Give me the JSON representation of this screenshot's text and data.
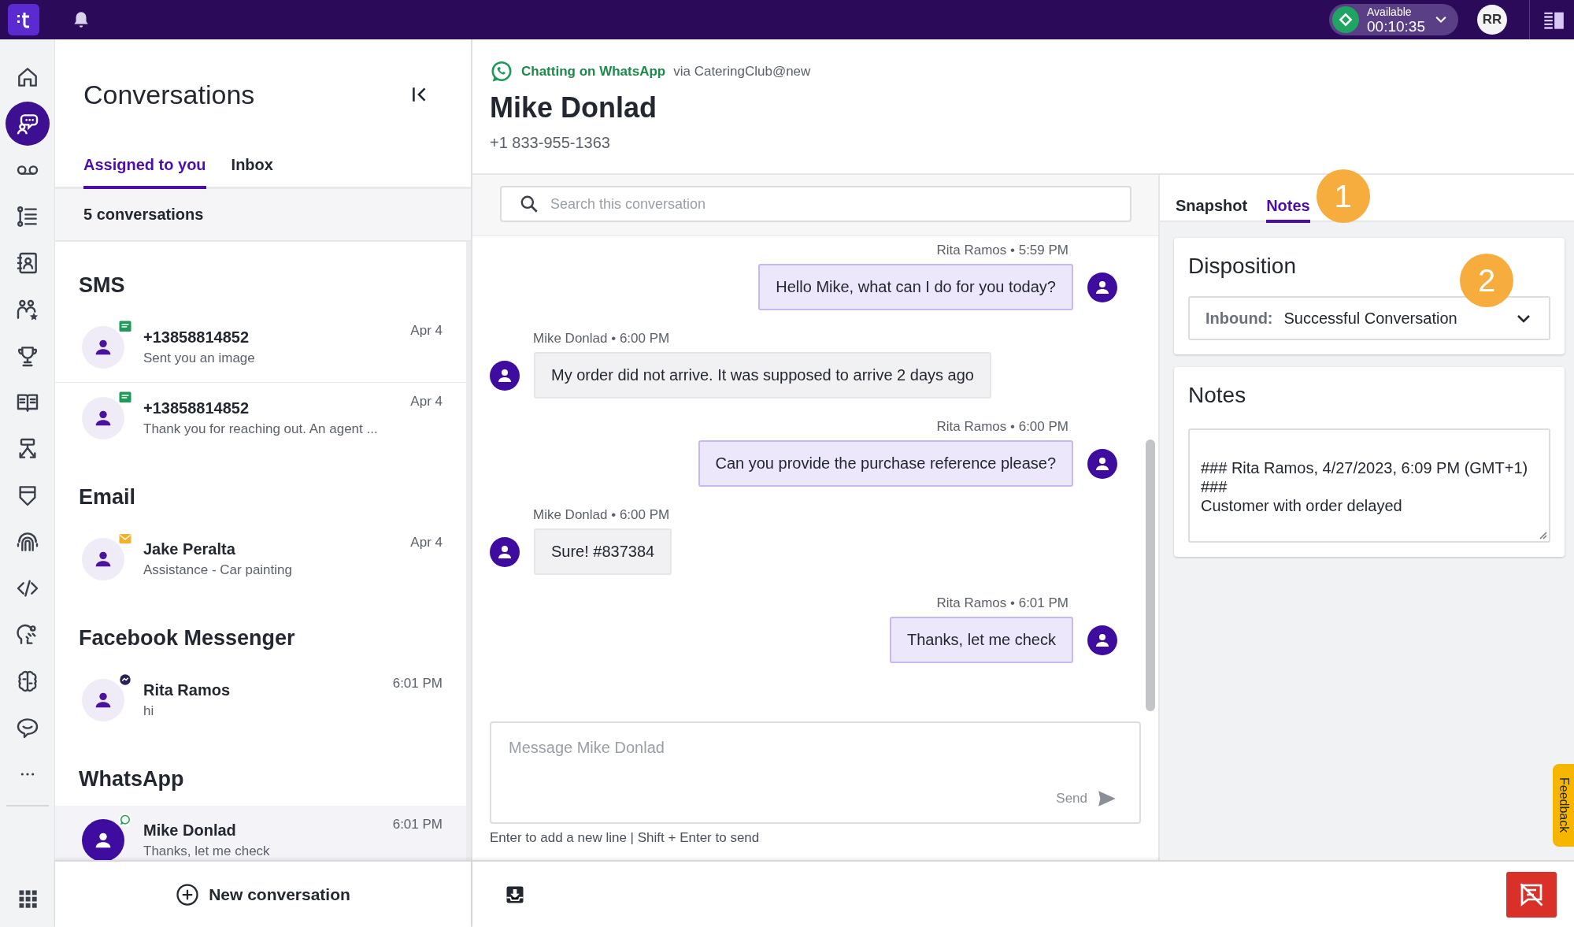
{
  "top_bar": {
    "status": {
      "label": "Available",
      "timer": "00:10:35"
    },
    "avatar_initials": "RR"
  },
  "nav": {
    "items": [
      {
        "kind": "home",
        "selected": false
      },
      {
        "kind": "chat",
        "selected": true
      },
      {
        "kind": "voicemail",
        "selected": false
      },
      {
        "kind": "list",
        "selected": false
      },
      {
        "kind": "contacts",
        "selected": false
      },
      {
        "kind": "team",
        "selected": false
      },
      {
        "kind": "trophy",
        "selected": false
      },
      {
        "kind": "book",
        "selected": false
      },
      {
        "kind": "flow",
        "selected": false
      },
      {
        "kind": "shield",
        "selected": false
      },
      {
        "kind": "fingerprint",
        "selected": false
      },
      {
        "kind": "code",
        "selected": false
      },
      {
        "kind": "head",
        "selected": false
      },
      {
        "kind": "brain",
        "selected": false
      },
      {
        "kind": "bubble",
        "selected": false
      },
      {
        "kind": "more",
        "selected": false
      }
    ]
  },
  "conversations": {
    "title": "Conversations",
    "tabs": [
      {
        "label": "Assigned to you",
        "selected": true
      },
      {
        "label": "Inbox",
        "selected": false
      }
    ],
    "count": "5 conversations",
    "groups": [
      {
        "title": "SMS",
        "items": [
          {
            "kind": "sms",
            "name": "+13858814852",
            "preview": "Sent you an image",
            "time": "Apr 4",
            "selected": false
          },
          {
            "kind": "sms",
            "name": "+13858814852",
            "preview": "Thank you for reaching out. An agent ...",
            "time": "Apr 4",
            "selected": false
          }
        ]
      },
      {
        "title": "Email",
        "items": [
          {
            "kind": "email",
            "name": "Jake Peralta",
            "preview": "Assistance - Car painting",
            "time": "Apr 4",
            "selected": false
          }
        ]
      },
      {
        "title": "Facebook Messenger",
        "items": [
          {
            "kind": "messenger",
            "name": "Rita Ramos",
            "preview": "hi",
            "time": "6:01 PM",
            "selected": false
          }
        ]
      },
      {
        "title": "WhatsApp",
        "items": [
          {
            "kind": "whatsapp",
            "name": "Mike Donlad",
            "preview": "Thanks, let me check",
            "time": "6:01 PM",
            "selected": true
          }
        ]
      }
    ],
    "new_button": "New conversation"
  },
  "chat": {
    "channel_label": "Chatting on WhatsApp",
    "via": "via CateringClub@new",
    "contact_name": "Mike Donlad",
    "phone": "+1 833-955-1363",
    "search_placeholder": "Search this conversation",
    "messages": [
      {
        "kind": "agent",
        "meta": "Rita Ramos • 5:59 PM",
        "text": "Hello Mike, what can I do for you today?"
      },
      {
        "kind": "customer",
        "meta": "Mike Donlad • 6:00 PM",
        "text": "My order did not arrive. It was supposed to arrive 2 days ago"
      },
      {
        "kind": "agent",
        "meta": "Rita Ramos • 6:00 PM",
        "text": "Can you provide the purchase reference please?"
      },
      {
        "kind": "customer",
        "meta": "Mike Donlad • 6:00 PM",
        "text": "Sure! #837384"
      },
      {
        "kind": "agent",
        "meta": "Rita Ramos • 6:01 PM",
        "text": "Thanks, let me check"
      }
    ],
    "composer": {
      "placeholder": "Message Mike Donlad",
      "send": "Send",
      "hint": "Enter to add a new line | Shift + Enter to send"
    }
  },
  "details": {
    "tabs": [
      {
        "label": "Snapshot",
        "selected": false
      },
      {
        "label": "Notes",
        "selected": true
      }
    ],
    "disposition": {
      "title": "Disposition",
      "label": "Inbound:",
      "value": "Successful Conversation"
    },
    "notes": {
      "title": "Notes",
      "value": "### Rita Ramos, 4/27/2023, 6:09 PM (GMT+1)\n###\nCustomer with order delayed"
    }
  },
  "feedback": "Feedback",
  "annotations": [
    "1",
    "2"
  ]
}
